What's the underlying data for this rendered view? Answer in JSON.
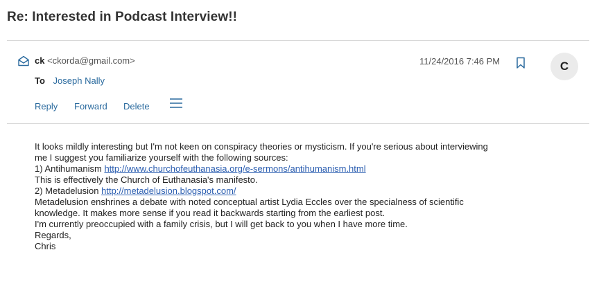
{
  "email": {
    "subject": "Re: Interested in Podcast Interview!!",
    "sender_name": "ck",
    "sender_email": "<ckorda@gmail.com>",
    "to_label": "To",
    "to_name": "Joseph Nally",
    "date": "11/24/2016 7:46 PM",
    "avatar_initial": "C"
  },
  "actions": {
    "reply": "Reply",
    "forward": "Forward",
    "delete": "Delete"
  },
  "icons": {
    "envelope": "envelope-open-icon",
    "bookmark": "bookmark-icon",
    "menu": "hamburger-menu-icon"
  },
  "colors": {
    "link": "#2a5db0",
    "action": "#2a6a9e",
    "divider": "#d8d8d8",
    "avatar_bg": "#ebebeb"
  },
  "body": {
    "l1": "It looks mildly interesting but I'm not keen on conspiracy theories or mysticism. If you're serious about interviewing",
    "l2": "me I suggest you familiarize yourself with the following sources:",
    "l3_prefix": "1) Antihumanism ",
    "l3_link": "http://www.churchofeuthanasia.org/e-sermons/antihumanism.html",
    "l4": "This is effectively the Church of Euthanasia's manifesto.",
    "l5_prefix": "2) Metadelusion ",
    "l5_link": "http://metadelusion.blogspot.com/",
    "l6": "Metadelusion enshrines a debate with noted conceptual artist Lydia Eccles over the specialness of scientific",
    "l7": "knowledge. It makes more sense if you read it backwards starting from the earliest post.",
    "l8": "I'm currently preoccupied with a family crisis, but I will get back to you when I have more time.",
    "l9": "Regards,",
    "l10": "Chris"
  }
}
